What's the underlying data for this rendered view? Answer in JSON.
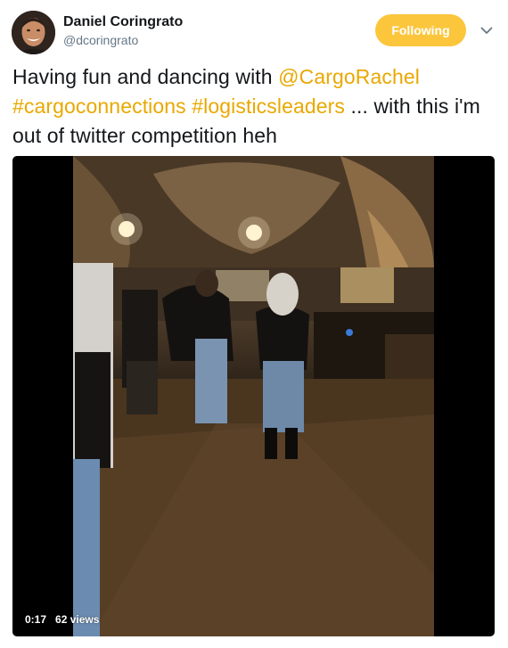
{
  "user": {
    "display_name": "Daniel Coringrato",
    "handle": "@dcoringrato",
    "avatar_icon": "profile-photo"
  },
  "follow_button": {
    "label": "Following",
    "color": "#fbc63c"
  },
  "menu_icon": "chevron-down-icon",
  "tweet": {
    "text_before": "Having fun and dancing with ",
    "mention": "@CargoRachel",
    "hashtag1": "#cargoconnections",
    "hashtag2": "#logisticsleaders",
    "text_after": " ... with this i'm out of twitter competition heh",
    "link_color": "#e9a800"
  },
  "video": {
    "time": "0:17",
    "views": "62 views"
  }
}
